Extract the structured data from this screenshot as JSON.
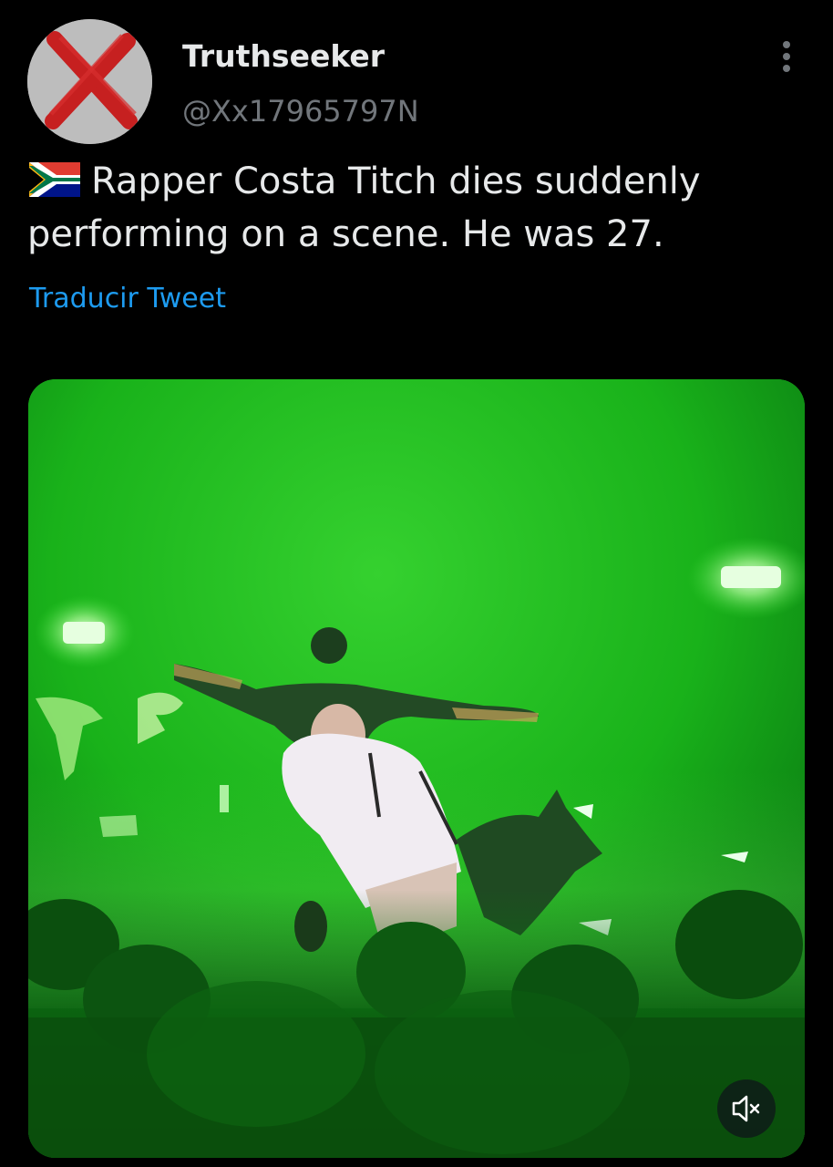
{
  "tweet": {
    "author": {
      "display_name": "Truthseeker",
      "handle": "@Xx17965797N",
      "avatar_icon": "red-x-icon"
    },
    "more_icon": "more-vertical-icon",
    "flag_icon": "south-africa-flag-icon",
    "text": "Rapper Costa Titch dies suddenly performing on a scene. He was 27.",
    "translate_label": "Traducir Tweet",
    "media": {
      "type": "video",
      "mute_icon": "volume-muted-icon"
    }
  },
  "colors": {
    "background": "#000000",
    "primary_text": "#e7e9ea",
    "secondary_text": "#71767b",
    "link": "#1d9bf0",
    "stage_green": "#17b51c"
  }
}
